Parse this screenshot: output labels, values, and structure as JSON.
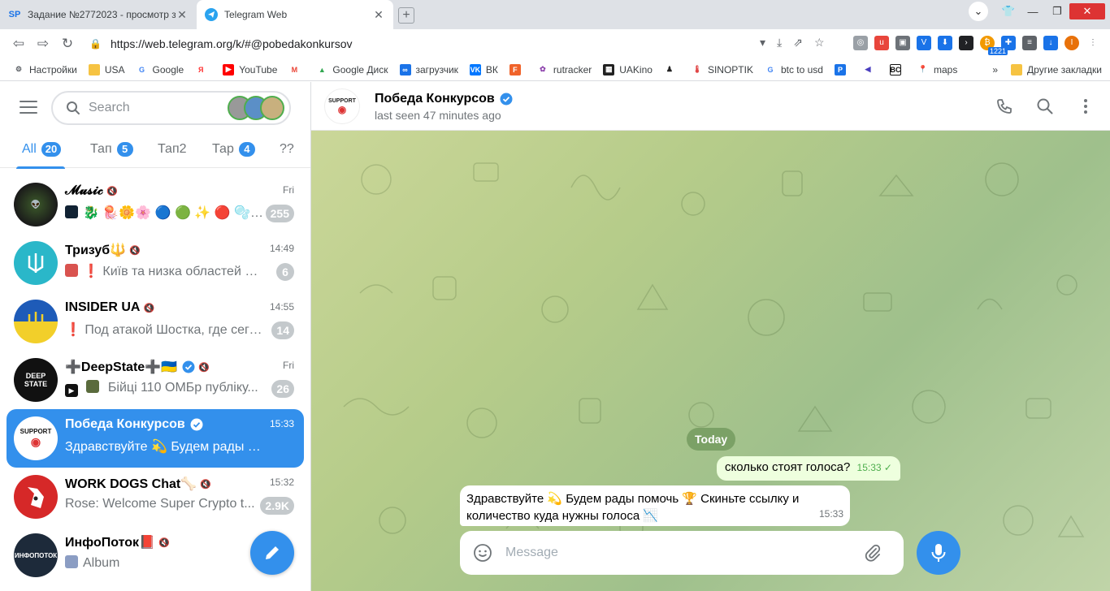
{
  "browser": {
    "tabs": [
      {
        "title": "Задание №2772023 - просмотр з",
        "favicon_text": "SP"
      },
      {
        "title": "Telegram Web",
        "favicon_text": ""
      }
    ],
    "url": "https://web.telegram.org/k/#@pobedakonkursov",
    "extension_badge": "1221",
    "profile_initial": "I",
    "bookmarks": [
      {
        "label": "Настройки",
        "icon": "gear-icon"
      },
      {
        "label": "USA",
        "icon": "folder-icon"
      },
      {
        "label": "Google",
        "icon": "google-icon"
      },
      {
        "label": "",
        "icon": "yandex-icon"
      },
      {
        "label": "YouTube",
        "icon": "youtube-icon"
      },
      {
        "label": "",
        "icon": "gmail-icon"
      },
      {
        "label": "Google Диск",
        "icon": "drive-icon"
      },
      {
        "label": "загрузчик",
        "icon": "infinity-icon"
      },
      {
        "label": "ВК",
        "icon": "vk-icon"
      },
      {
        "label": "",
        "icon": "f-icon"
      },
      {
        "label": "rutracker",
        "icon": "rutracker-icon"
      },
      {
        "label": "UAKino",
        "icon": "uakino-icon"
      },
      {
        "label": "",
        "icon": "figure-icon"
      },
      {
        "label": "SINOPTIK",
        "icon": "thermometer-icon"
      },
      {
        "label": "btc to usd",
        "icon": "google-icon"
      },
      {
        "label": "",
        "icon": "p-icon"
      },
      {
        "label": "",
        "icon": "arrow-icon"
      },
      {
        "label": "",
        "icon": "bc-icon"
      },
      {
        "label": "maps",
        "icon": "maps-icon"
      }
    ],
    "bookmarks_more": "»",
    "other_bookmarks": "Другие закладки"
  },
  "sidebar": {
    "search_placeholder": "Search",
    "folders": [
      {
        "label": "All",
        "badge": "20"
      },
      {
        "label": "Тап",
        "badge": "5"
      },
      {
        "label": "Тап2",
        "badge": ""
      },
      {
        "label": "Тар",
        "badge": "4"
      },
      {
        "label": "??",
        "badge": ""
      }
    ],
    "chats": [
      {
        "name": "𝓜𝓾𝓼𝓲𝓬",
        "time": "Fri",
        "preview": "🐉 🪼🌼🌸 🔵 🟢 ✨ 🔴 🫧🦋💜",
        "unread": "255"
      },
      {
        "name": "Тризуб🔱",
        "time": "14:49",
        "preview": "❗ Київ та низка областей — ...",
        "unread": "6"
      },
      {
        "name": "INSIDER UA",
        "time": "14:55",
        "preview": "❗ Под атакой Шостка, где сего...",
        "unread": "14"
      },
      {
        "name": "➕DeepState➕🇺🇦",
        "time": "Fri",
        "preview": "Бійці 110 ОМБр публіку...",
        "unread": "26"
      },
      {
        "name": "Победа Конкурсов",
        "time": "15:33",
        "preview": "Здравствуйте 💫 Будем рады помо...",
        "unread": ""
      },
      {
        "name": "WORK DOGS Chat🦴",
        "time": "15:32",
        "preview": "Rose: Welcome Super Crypto t...",
        "unread": "2.9K"
      },
      {
        "name": "ИнфоПоток📕",
        "time": "",
        "preview": "Album",
        "unread": ""
      }
    ]
  },
  "chat": {
    "title": "Победа Конкурсов",
    "status": "last seen 47 minutes ago",
    "date_label": "Today",
    "messages": [
      {
        "direction": "out",
        "text": "сколько стоят голоса?",
        "time": "15:33",
        "check": "✓"
      },
      {
        "direction": "in",
        "text_line1": "Здравствуйте 💫 Будем рады помочь 🏆 Скиньте ссылку и",
        "text_line2": "количество куда нужны голоса 📉",
        "time": "15:33"
      }
    ],
    "composer_placeholder": "Message"
  },
  "colors": {
    "accent": "#3390ec",
    "outgoing_bubble": "#eeffde",
    "unread_muted": "#c4c9cc"
  }
}
